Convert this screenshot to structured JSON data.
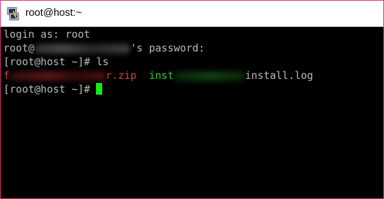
{
  "window": {
    "title": "root@host:~",
    "icon": "putty-terminal-icon",
    "border_color": "#e0306a"
  },
  "terminal": {
    "colors": {
      "background": "#000000",
      "foreground": "#bbbbbb",
      "archive": "#e03c3c",
      "directory": "#2bd52b",
      "cursor": "#11ee11"
    },
    "line1": {
      "text": "login as: root"
    },
    "line2": {
      "prefix": "root@",
      "suffix": "'s password:"
    },
    "line3": {
      "text": "[root@host ~]# ls"
    },
    "line4": {
      "file1_start": "f",
      "file1_end": "r.zip",
      "dir": "inst",
      "log": "install.log"
    },
    "line5": {
      "prompt": "[root@host ~]# "
    }
  }
}
